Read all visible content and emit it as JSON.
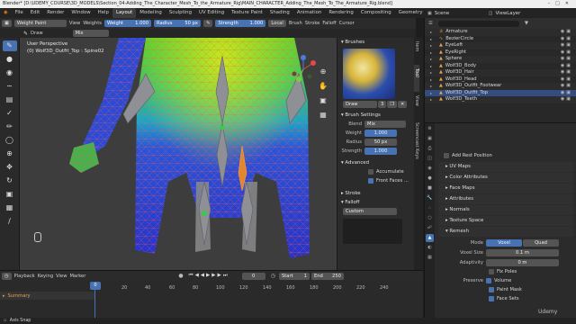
{
  "title_bar": {
    "text": "Blender* [D:\\UDEMY_COURSE\\3D_MODELS\\Section_04-Adding_The_Character_Mesh_To_the_Armature_Rig\\MAIN_CHARACTER_Adding_The_Mesh_To_The_Armature_Rig.blend]"
  },
  "menu": {
    "items": [
      "File",
      "Edit",
      "Render",
      "Window",
      "Help"
    ],
    "workspaces": [
      "Layout",
      "Modeling",
      "Sculpting",
      "UV Editing",
      "Texture Paint",
      "Shading",
      "Animation",
      "Rendering",
      "Compositing",
      "Geometry Nodes"
    ],
    "active_workspace": "Layout",
    "scene_label": "Scene",
    "view_layer_label": "ViewLayer"
  },
  "header": {
    "mode": "Weight Paint",
    "view": "View",
    "weights": "Weights",
    "weight_label": "Weight",
    "weight_value": "1.000",
    "radius_label": "Radius",
    "radius_value": "50 px",
    "strength_label": "Strength",
    "strength_value": "1.000",
    "orientation": "Local",
    "brush_tab": "Brush",
    "stroke_tab": "Stroke",
    "falloff_tab": "Falloff",
    "cursor_tab": "Cursor"
  },
  "tool_header": {
    "draw": "Draw",
    "mix": "Mix"
  },
  "viewport": {
    "perspective": "User Perspective",
    "object_info": "(0) Wolf3D_Outfit_Top : Spine02"
  },
  "npanel": {
    "tabs": [
      "Item",
      "Tool",
      "View",
      "Screencast Keys"
    ],
    "active_tab": "Tool",
    "brushes_header": "Brushes",
    "brush_name": "Draw",
    "brush_users": "3",
    "brush_settings_header": "Brush Settings",
    "blend_label": "Blend",
    "blend_value": "Mix",
    "weight_label": "Weight",
    "weight_value": "1.000",
    "radius_label": "Radius",
    "radius_value": "50 px",
    "strength_label": "Strength",
    "strength_value": "1.000",
    "advanced_header": "Advanced",
    "accumulate_label": "Accumulate",
    "front_faces_label": "Front Faces ...",
    "stroke_header": "Stroke",
    "falloff_header": "Falloff",
    "falloff_preset": "Custom"
  },
  "outliner": {
    "search_placeholder": "",
    "rows": [
      {
        "name": "Armature",
        "icon": "armature-icon"
      },
      {
        "name": "BezierCircle",
        "icon": "curve-icon"
      },
      {
        "name": "EyeLeft",
        "icon": "mesh-icon"
      },
      {
        "name": "EyeRight",
        "icon": "mesh-icon"
      },
      {
        "name": "Sphere",
        "icon": "mesh-icon"
      },
      {
        "name": "Wolf3D_Body",
        "icon": "mesh-icon"
      },
      {
        "name": "Wolf3D_Hair",
        "icon": "mesh-icon"
      },
      {
        "name": "Wolf3D_Head",
        "icon": "mesh-icon"
      },
      {
        "name": "Wolf3D_Outfit_Footwear",
        "icon": "mesh-icon"
      },
      {
        "name": "Wolf3D_Outfit_Top",
        "icon": "mesh-icon"
      },
      {
        "name": "Wolf3D_Teeth",
        "icon": "mesh-icon"
      }
    ]
  },
  "properties": {
    "add_rest_position": "Add Rest Position",
    "sections": [
      "UV Maps",
      "Color Attributes",
      "Face Maps",
      "Attributes",
      "Normals",
      "Texture Space",
      "Remesh"
    ],
    "remesh": {
      "mode_label": "Mode",
      "mode_voxel": "Voxel",
      "mode_quad": "Quad",
      "voxel_size_label": "Voxel Size",
      "voxel_size_value": "0.1 m",
      "adaptivity_label": "Adaptivity",
      "adaptivity_value": "0 m",
      "fix_poles_label": "Fix Poles",
      "preserve_label": "Preserve",
      "volume_label": "Volume",
      "paint_mask_label": "Paint Mask",
      "face_sets_label": "Face Sets"
    }
  },
  "timeline": {
    "playback": "Playback",
    "keying": "Keying",
    "view": "View",
    "marker": "Marker",
    "current_frame": "0",
    "start_label": "Start",
    "start_value": "1",
    "end_label": "End",
    "end_value": "250",
    "summary_label": "Summary",
    "ticks": [
      "20",
      "40",
      "60",
      "80",
      "100",
      "120",
      "140",
      "160",
      "180",
      "200",
      "220",
      "240"
    ]
  },
  "status": {
    "text": "Axis Snap",
    "watermark": "Udemy"
  }
}
